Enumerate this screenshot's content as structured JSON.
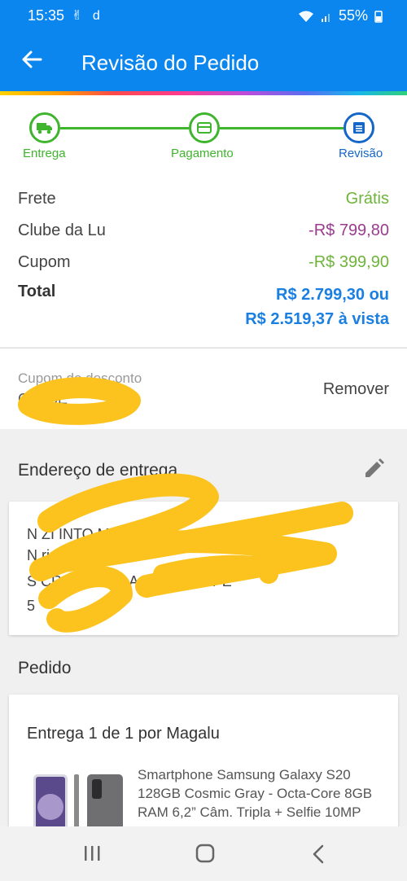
{
  "status_bar": {
    "time": "15:35",
    "notif_icons": "✌ d",
    "battery": "55%"
  },
  "app_bar": {
    "title": "Revisão do Pedido"
  },
  "stepper": {
    "steps": [
      "Entrega",
      "Pagamento",
      "Revisão"
    ],
    "active": 2
  },
  "summary": {
    "frete": {
      "label": "Frete",
      "value": "Grátis"
    },
    "clube": {
      "label": "Clube da Lu",
      "value": "-R$ 799,80"
    },
    "cupom": {
      "label": "Cupom",
      "value": "-R$ 399,90"
    },
    "total": {
      "label": "Total",
      "value_line1": "R$ 2.799,30 ou",
      "value_line2": "R$ 2.519,37 à vista"
    }
  },
  "coupon": {
    "label": "Cupom de desconto",
    "code": "C          UICE",
    "remove": "Remover"
  },
  "address": {
    "title": "Endereço de entrega",
    "line1": "N     ZI      INTO     MPOS, sn -",
    "line2": "N        ri",
    "line3": "S  CRISTOVAO       A TALHADA/PE",
    "line4": "5"
  },
  "order": {
    "title": "Pedido",
    "shipment": "Entrega 1 de 1 por Magalu",
    "product_name": "Smartphone Samsung Galaxy S20 128GB Cosmic Gray - Octa-Core 8GB RAM 6,2” Câm. Tripla + Selfie 10MP"
  },
  "colors": {
    "primary": "#0a86ee",
    "step_done": "#3fb42d",
    "step_active": "#1466c8",
    "price_blue": "#1a7fe0",
    "discount_purple": "#9b3b8f",
    "discount_green": "#6fb43a"
  }
}
